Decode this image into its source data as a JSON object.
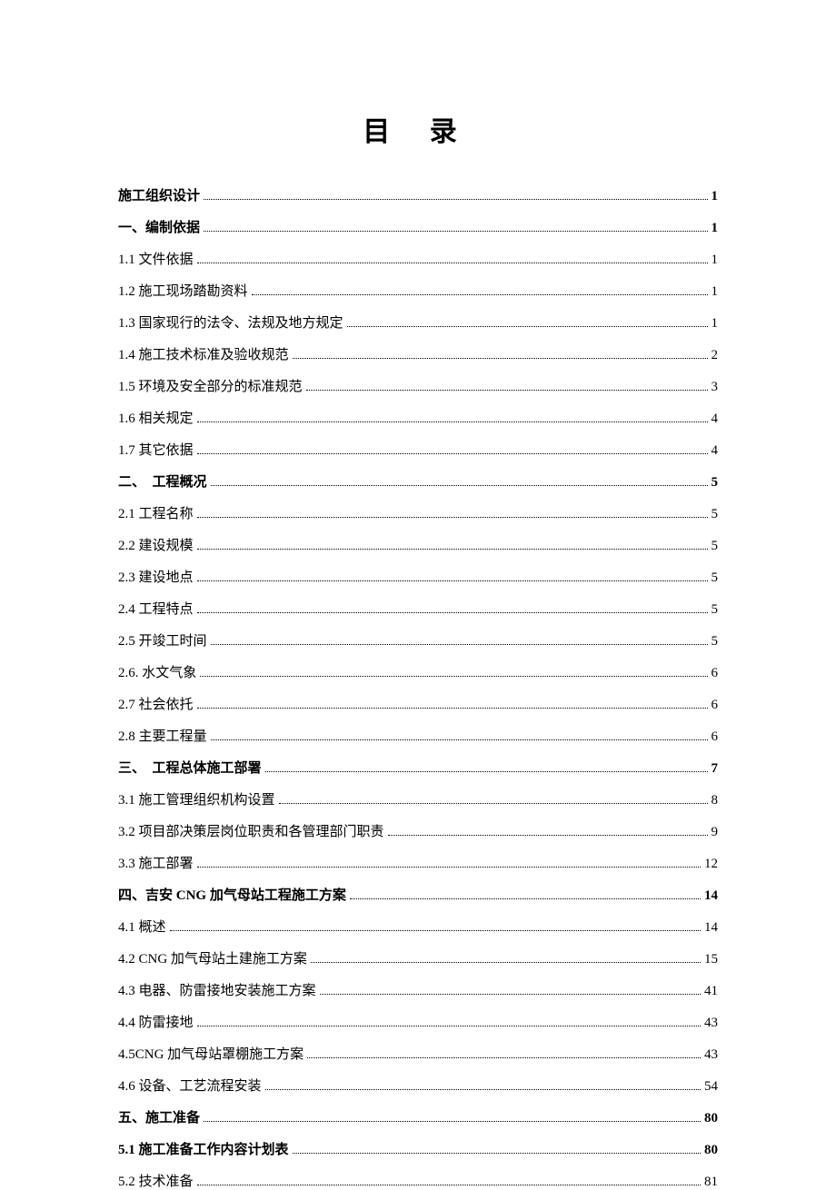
{
  "title": "目 录",
  "toc": [
    {
      "label": "施工组织设计",
      "page": "1",
      "bold": true
    },
    {
      "label": "一、编制依据",
      "page": "1",
      "bold": true
    },
    {
      "label": "1.1 文件依据",
      "page": "1",
      "bold": false
    },
    {
      "label": "1.2 施工现场踏勘资料",
      "page": "1",
      "bold": false
    },
    {
      "label": "1.3 国家现行的法令、法规及地方规定",
      "page": "1",
      "bold": false
    },
    {
      "label": "1.4 施工技术标准及验收规范",
      "page": "2",
      "bold": false
    },
    {
      "label": "1.5 环境及安全部分的标准规范",
      "page": "3",
      "bold": false
    },
    {
      "label": "1.6 相关规定",
      "page": "4",
      "bold": false
    },
    {
      "label": "1.7 其它依据",
      "page": "4",
      "bold": false
    },
    {
      "label": "二、　工程概况",
      "page": "5",
      "bold": true
    },
    {
      "label": "2.1 工程名称",
      "page": "5",
      "bold": false
    },
    {
      "label": "2.2 建设规模",
      "page": "5",
      "bold": false
    },
    {
      "label": "2.3 建设地点",
      "page": "5",
      "bold": false
    },
    {
      "label": "2.4 工程特点",
      "page": "5",
      "bold": false
    },
    {
      "label": "2.5 开竣工时间",
      "page": "5",
      "bold": false
    },
    {
      "label": "2.6. 水文气象",
      "page": "6",
      "bold": false
    },
    {
      "label": "2.7 社会依托",
      "page": "6",
      "bold": false
    },
    {
      "label": "2.8 主要工程量",
      "page": "6",
      "bold": false
    },
    {
      "label": "三、　工程总体施工部署",
      "page": "7",
      "bold": true
    },
    {
      "label": "3.1 施工管理组织机构设置",
      "page": "8",
      "bold": false
    },
    {
      "label": "3.2 项目部决策层岗位职责和各管理部门职责",
      "page": "9",
      "bold": false
    },
    {
      "label": "3.3 施工部署",
      "page": "12",
      "bold": false
    },
    {
      "label": "四、吉安 CNG 加气母站工程施工方案",
      "page": "14",
      "bold": true
    },
    {
      "label": "4.1 概述",
      "page": "14",
      "bold": false
    },
    {
      "label": "4.2 CNG 加气母站土建施工方案",
      "page": "15",
      "bold": false
    },
    {
      "label": "4.3 电器、防雷接地安装施工方案",
      "page": "41",
      "bold": false
    },
    {
      "label": "4.4 防雷接地",
      "page": "43",
      "bold": false
    },
    {
      "label": "4.5CNG 加气母站罩棚施工方案",
      "page": "43",
      "bold": false
    },
    {
      "label": "4.6 设备、工艺流程安装",
      "page": "54",
      "bold": false
    },
    {
      "label": "五、施工准备",
      "page": "80",
      "bold": true
    },
    {
      "label": "5.1 施工准备工作内容计划表",
      "page": "80",
      "bold": true
    },
    {
      "label": "5.2 技术准备",
      "page": "81",
      "bold": false
    }
  ]
}
